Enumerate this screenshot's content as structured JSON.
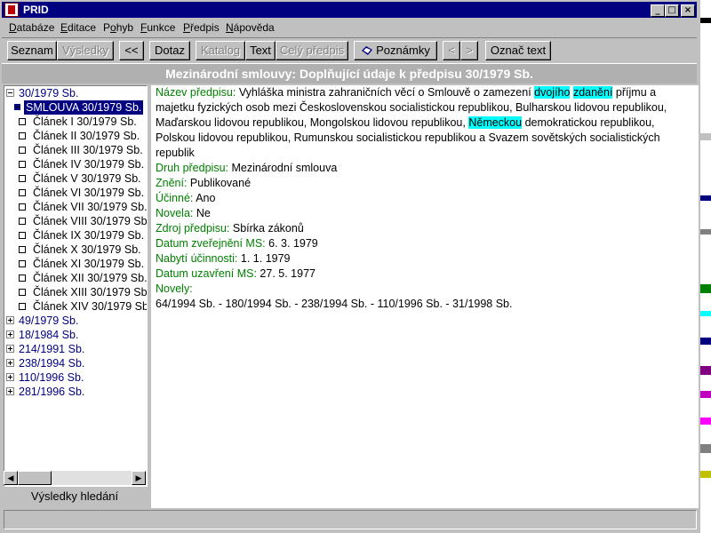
{
  "window": {
    "title": "PRID",
    "min_glyph": "_",
    "max_glyph": "□",
    "close_glyph": "×"
  },
  "menu": [
    {
      "pre": "",
      "key": "D",
      "post": "atabáze"
    },
    {
      "pre": "",
      "key": "E",
      "post": "ditace"
    },
    {
      "pre": "P",
      "key": "o",
      "post": "hyb"
    },
    {
      "pre": "",
      "key": "F",
      "post": "unkce"
    },
    {
      "pre": "",
      "key": "P",
      "post": "ředpis"
    },
    {
      "pre": "",
      "key": "N",
      "post": "ápověda"
    }
  ],
  "toolbar": {
    "seznam": "Seznam",
    "vysledky": "Výsledky",
    "back": "<<",
    "dotaz": "Dotaz",
    "katalog": "Katalog",
    "text": "Text",
    "cely_predpis": "Celý předpis",
    "poznamky": "Poznámky",
    "prev": "<",
    "next": ">",
    "oznac_text": "Označ text"
  },
  "heading": "Mezinárodní smlouvy:   Doplňující údaje k předpisu 30/1979 Sb.",
  "tree": {
    "root": "30/1979 Sb.",
    "selected": "SMLOUVA 30/1979 Sb.",
    "articles": [
      "Článek I 30/1979 Sb.",
      "Článek II 30/1979 Sb.",
      "Článek III 30/1979 Sb.",
      "Článek IV 30/1979 Sb.",
      "Článek V 30/1979 Sb.",
      "Článek VI 30/1979 Sb.",
      "Článek VII 30/1979 Sb.",
      "Článek VIII 30/1979 Sb.",
      "Článek IX 30/1979 Sb.",
      "Článek X 30/1979 Sb.",
      "Článek XI 30/1979 Sb.",
      "Článek XII 30/1979 Sb.",
      "Článek XIII 30/1979 Sb.",
      "Článek XIV 30/1979 Sb."
    ],
    "others": [
      "49/1979 Sb.",
      "18/1984 Sb.",
      "214/1991 Sb.",
      "238/1994 Sb.",
      "110/1996 Sb.",
      "281/1996 Sb."
    ]
  },
  "search_results_label": "Výsledky hledání",
  "detail": {
    "nazev_label": "Název předpisu:",
    "nazev_l1a": "Vyhláška ministra zahraničních věcí o Smlouvě o zamezení",
    "nazev_hl1": "dvojího",
    "nazev_hl2": "zdanění",
    "nazev_l1b": "příjmu a",
    "nazev_l2": "majetku fyzických osob mezi Československou socialistickou republikou, Bulharskou lidovou republikou,",
    "nazev_l3a": "Maďarskou lidovou republikou, Mongolskou lidovou republikou,",
    "nazev_hl3": "Německou",
    "nazev_l3b": "demokratickou republikou,",
    "nazev_l4": "Polskou lidovou republikou, Rumunskou socialistickou republikou a Svazem sovětských socialistických",
    "nazev_l5": "republik",
    "druh_label": "Druh předpisu:",
    "druh": "Mezinárodní smlouva",
    "zneni_label": "Znění:",
    "zneni": "Publikované",
    "ucinne_label": "Účinné:",
    "ucinne": "Ano",
    "novela_label": "Novela:",
    "novela": "Ne",
    "zdroj_label": "Zdroj předpisu:",
    "zdroj": "Sbírka zákonů",
    "datum_zver_label": "Datum zveřejnění MS:",
    "datum_zver": "6. 3. 1979",
    "nabyti_label": "Nabytí účinnosti:",
    "nabyti": "1. 1. 1979",
    "datum_uzav_label": "Datum uzavření MS:",
    "datum_uzav": "27. 5. 1977",
    "novely_label": "Novely:",
    "novely": "64/1994 Sb. - 180/1994 Sb. - 238/1994 Sb. - 110/1996 Sb. - 31/1998 Sb."
  },
  "colors": {
    "title_bar": "#000080",
    "label_green": "#008000",
    "highlight": "#00ffff",
    "tree_link": "#000080"
  }
}
